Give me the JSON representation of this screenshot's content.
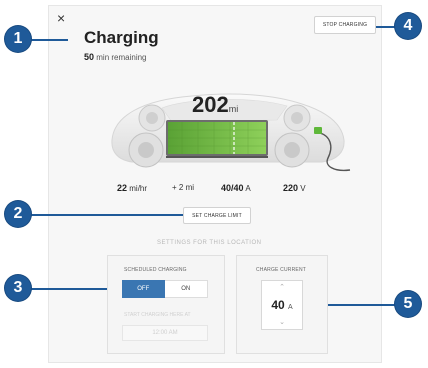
{
  "header": {
    "title": "Charging",
    "remaining_value": "50",
    "remaining_text": "min remaining",
    "close_symbol": "×",
    "stop_button": "STOP CHARGING"
  },
  "range": {
    "value": "202",
    "unit": "mi"
  },
  "stats": {
    "rate_value": "22",
    "rate_unit": "mi/hr",
    "added_value": "+ 2",
    "added_unit": "mi",
    "current_value": "40/40",
    "current_unit": "A",
    "voltage_value": "220",
    "voltage_unit": "V"
  },
  "set_charge_limit": "SET CHARGE LIMIT",
  "settings": {
    "section_title": "SETTINGS FOR THIS LOCATION",
    "scheduled_label": "SCHEDULED CHARGING",
    "toggle_off": "OFF",
    "toggle_on": "ON",
    "toggle_selected": "OFF",
    "start_label": "START CHARGING HERE AT",
    "start_time": "12:00 AM",
    "current_label": "CHARGE CURRENT",
    "charge_current_value": "40",
    "charge_current_unit": "A"
  },
  "callouts": [
    "1",
    "2",
    "3",
    "4",
    "5"
  ],
  "colors": {
    "callout": "#1f5a99",
    "battery": "#7cc24a",
    "toggle_active": "#3a76b2",
    "plug": "#5fb83a"
  },
  "icons": {
    "close": "close-icon",
    "up": "chevron-up-icon",
    "down": "chevron-down-icon",
    "charge_plug": "charge-plug-icon"
  }
}
